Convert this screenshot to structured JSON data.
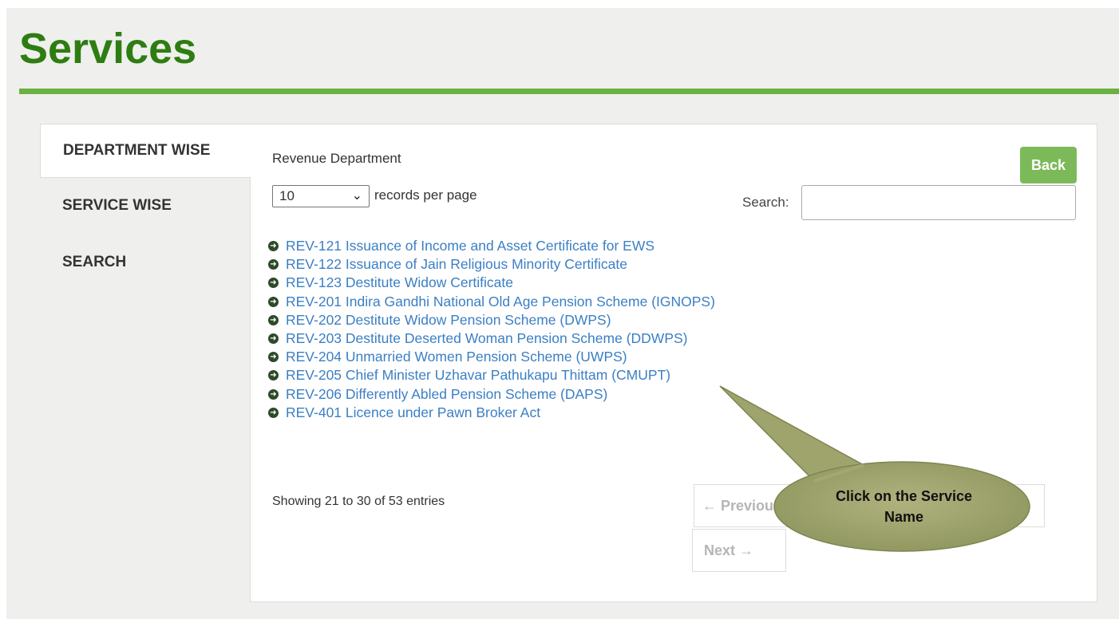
{
  "page": {
    "title": "Services"
  },
  "tabs": [
    {
      "label": "DEPARTMENT WISE",
      "active": true
    },
    {
      "label": "SERVICE WISE",
      "active": false
    },
    {
      "label": "SEARCH",
      "active": false
    }
  ],
  "panel": {
    "department": "Revenue Department",
    "back_label": "Back",
    "length_value": "10",
    "length_suffix": "records per page",
    "search_label": "Search:",
    "search_value": ""
  },
  "services": [
    "REV-121 Issuance of Income and Asset Certificate for EWS",
    "REV-122 Issuance of Jain Religious Minority Certificate",
    "REV-123 Destitute Widow Certificate",
    "REV-201 Indira Gandhi National Old Age Pension Scheme (IGNOPS)",
    "REV-202 Destitute Widow Pension Scheme (DWPS)",
    "REV-203 Destitute Deserted Woman Pension Scheme (DDWPS)",
    "REV-204 Unmarried Women Pension Scheme (UWPS)",
    "REV-205 Chief Minister Uzhavar Pathukapu Thittam (CMUPT)",
    "REV-206 Differently Abled Pension Scheme (DAPS)",
    "REV-401 Licence under Pawn Broker Act"
  ],
  "pagination": {
    "info": "Showing 21 to 30 of 53 entries",
    "prev_label": "← Previous",
    "next_label": "Next →"
  },
  "callout": {
    "line1": "Click on the Service",
    "line2": "Name",
    "color": "#9aa06a"
  },
  "icons": {
    "bullet": "circle-arrow-right-icon"
  },
  "colors": {
    "title": "#2e7d12",
    "rule": "#6bb242",
    "link": "#3b7fc4",
    "back_button": "#7cba59"
  }
}
